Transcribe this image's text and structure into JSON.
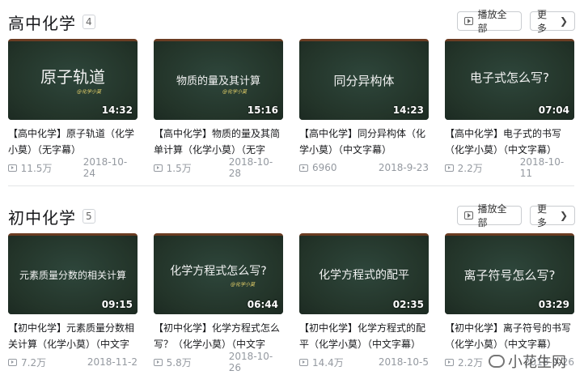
{
  "sections": [
    {
      "title": "高中化学",
      "count": "4",
      "play_all_label": "播放全部",
      "more_label": "更多",
      "videos": [
        {
          "board_text": "原子轨道",
          "board_sign": "@化学小莫",
          "duration": "14:32",
          "title": "【高中化学】原子轨道（化学小莫）（无字幕）",
          "views": "11.5万",
          "date": "2018-10-24"
        },
        {
          "board_text": "物质的量及其计算",
          "board_sign": "@化学小莫",
          "duration": "15:16",
          "title": "【高中化学】物质的量及其简单计算（化学小莫）（无字",
          "views": "1.5万",
          "date": "2018-10-28"
        },
        {
          "board_text": "同分异构体",
          "board_sign": "",
          "duration": "14:23",
          "title": "【高中化学】同分异构体（化学小莫）（中文字幕）",
          "views": "6960",
          "date": "2018-9-23"
        },
        {
          "board_text": "电子式怎么写?",
          "board_sign": "",
          "duration": "07:04",
          "title": "【高中化学】电子式的书写（化学小莫）（中文字幕）",
          "views": "2.2万",
          "date": "2018-10-11"
        }
      ]
    },
    {
      "title": "初中化学",
      "count": "5",
      "play_all_label": "播放全部",
      "more_label": "更多",
      "videos": [
        {
          "board_text": "元素质量分数的相关计算",
          "board_sign": "",
          "duration": "09:15",
          "title": "【初中化学】元素质量分数相关计算（化学小莫）（中文字",
          "views": "7.2万",
          "date": "2018-11-2"
        },
        {
          "board_text": "化学方程式怎么写?",
          "board_sign": "@化学小莫",
          "duration": "06:44",
          "title": "【初中化学】化学方程式怎么写？（化学小莫）（中文字",
          "views": "5.8万",
          "date": "2018-10-26"
        },
        {
          "board_text": "化学方程式的配平",
          "board_sign": "",
          "duration": "02:35",
          "title": "【初中化学】化学方程式的配平（化学小莫）（中文字幕）",
          "views": "14.4万",
          "date": "2018-10-5"
        },
        {
          "board_text": "离子符号怎么写?",
          "board_sign": "",
          "duration": "03:29",
          "title": "【初中化学】离子符号的书写（化学小莫）（中文字幕）",
          "views": "2.2万",
          "date": "2018-9-26"
        }
      ]
    }
  ],
  "watermark": "小花生网",
  "colors": {
    "board": "#24362e",
    "board_frame": "#6b3c22",
    "meta_gray": "#9499a0"
  }
}
